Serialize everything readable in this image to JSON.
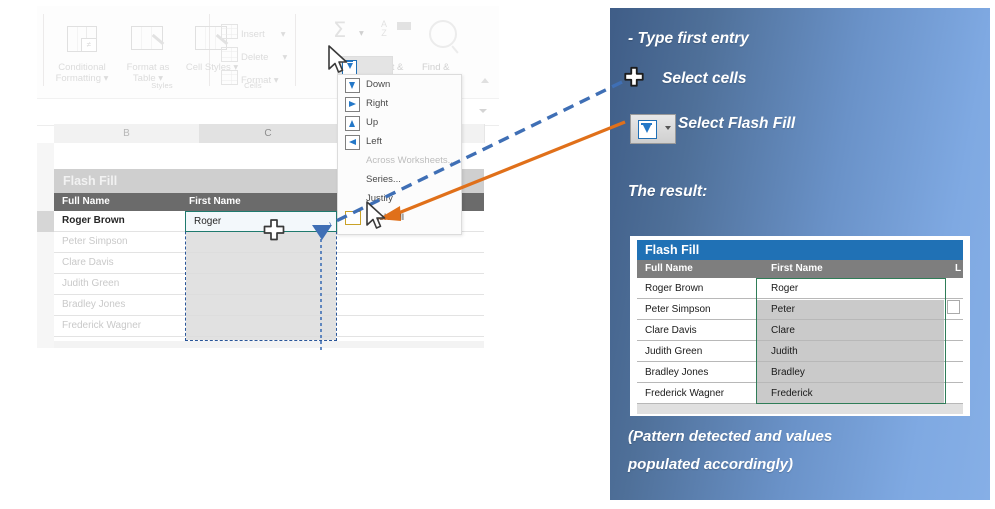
{
  "left_screenshot": {
    "ribbon": {
      "big_buttons": [
        {
          "label_line1": "Conditional",
          "label_line2": "Formatting",
          "icon": "conditional-formatting-icon"
        },
        {
          "label_line1": "Format as",
          "label_line2": "Table",
          "icon": "format-as-table-icon"
        },
        {
          "label_line1": "Cell",
          "label_line2": "Styles",
          "icon": "cell-styles-icon"
        }
      ],
      "small_buttons": [
        {
          "label": "Insert",
          "icon": "insert-cells-icon"
        },
        {
          "label": "Delete",
          "icon": "delete-cells-icon"
        },
        {
          "label": "Format",
          "icon": "format-cells-icon"
        }
      ],
      "group_labels": {
        "styles": "Styles",
        "cells": "Cells",
        "editing": ""
      },
      "editing": {
        "autosum": "Σ",
        "sort_filter": "Sort &",
        "find_select": "Find &",
        "az_letters": "A\nZ"
      }
    },
    "columns": [
      {
        "letter": "B",
        "selected": false
      },
      {
        "letter": "C",
        "selected": true
      }
    ],
    "table": {
      "banner": "Flash Fill",
      "headers": [
        "Full Name",
        "First Name"
      ],
      "rows": [
        {
          "full_name": "Roger Brown",
          "first_name": "Roger"
        },
        {
          "full_name": "Peter Simpson",
          "first_name": ""
        },
        {
          "full_name": "Clare Davis",
          "first_name": ""
        },
        {
          "full_name": "Judith Green",
          "first_name": ""
        },
        {
          "full_name": "Bradley Jones",
          "first_name": ""
        },
        {
          "full_name": "Frederick Wagner",
          "first_name": ""
        }
      ]
    },
    "fill_menu": {
      "items": [
        {
          "label": "Down",
          "accel": "D",
          "icon": "fill-down-icon",
          "disabled": false
        },
        {
          "label": "Right",
          "accel": "R",
          "icon": "fill-right-icon",
          "disabled": false
        },
        {
          "label": "Up",
          "accel": "U",
          "icon": "fill-up-icon",
          "disabled": false
        },
        {
          "label": "Left",
          "accel": "L",
          "icon": "fill-left-icon",
          "disabled": false
        },
        {
          "label": "Across Worksheets...",
          "accel": "A",
          "icon": "",
          "disabled": true
        },
        {
          "label": "Series...",
          "accel": "S",
          "icon": "",
          "disabled": false
        },
        {
          "label": "Justify",
          "accel": "J",
          "icon": "",
          "disabled": false
        },
        {
          "label": "Flash Fill",
          "accel": "F",
          "icon": "flash-fill-icon",
          "disabled": false
        }
      ]
    }
  },
  "panel": {
    "steps": [
      {
        "bullet": "dash",
        "text": "- Type first entry"
      },
      {
        "bullet": "plus-cursor-icon",
        "text": "Select cells"
      },
      {
        "bullet": "fill-button-icon",
        "text": "Select Flash Fill"
      }
    ],
    "result_heading": "The result:",
    "caption_line1": "(Pattern detected and values",
    "caption_line2": "populated accordingly)",
    "result_table": {
      "banner": "Flash Fill",
      "headers": [
        "Full Name",
        "First Name",
        "L"
      ],
      "rows": [
        {
          "full_name": "Roger Brown",
          "first_name": "Roger"
        },
        {
          "full_name": "Peter Simpson",
          "first_name": "Peter"
        },
        {
          "full_name": "Clare Davis",
          "first_name": "Clare"
        },
        {
          "full_name": "Judith Green",
          "first_name": "Judith"
        },
        {
          "full_name": "Bradley Jones",
          "first_name": "Bradley"
        },
        {
          "full_name": "Frederick Wagner",
          "first_name": "Frederick"
        }
      ]
    }
  },
  "colors": {
    "panel_dark": "#3f5d87",
    "panel_light": "#86afe6",
    "result_banner": "#2071b5",
    "selection_green": "#2f7d58",
    "arrow_blue": "#3f6fb5",
    "arrow_orange": "#e0701a"
  }
}
